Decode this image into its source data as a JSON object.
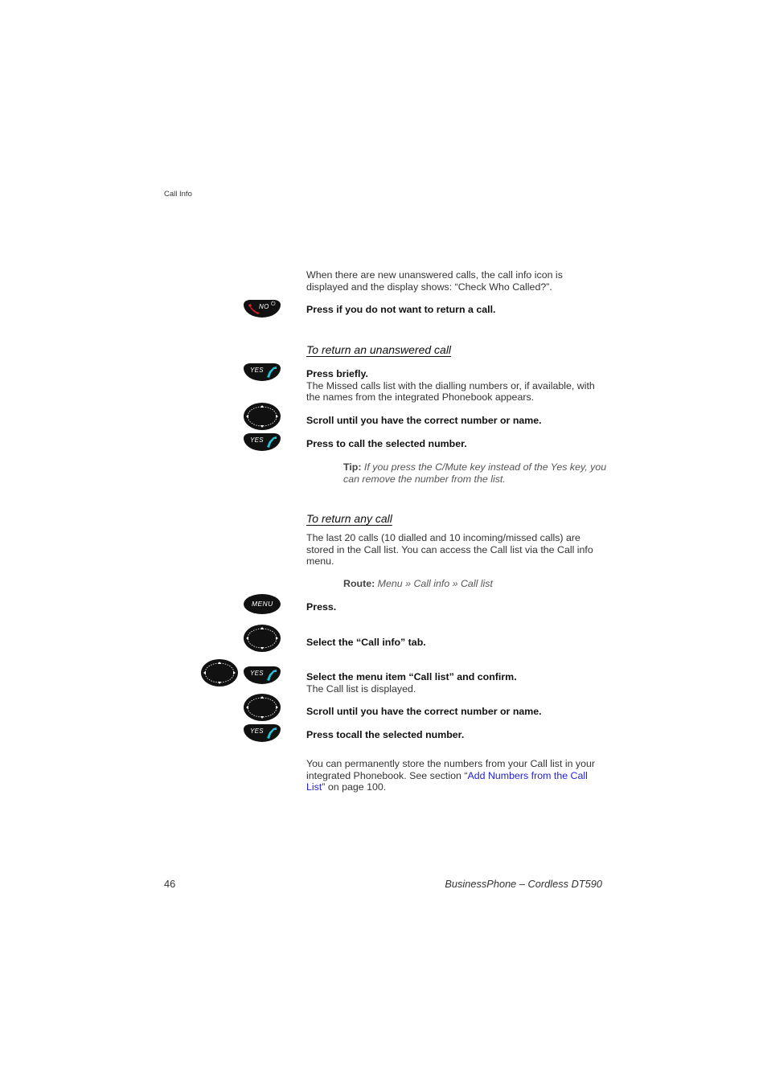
{
  "header": {
    "running_head": "Call Info"
  },
  "intro": {
    "text_line1": "When there are new unanswered calls, the call info icon is",
    "text_line2": "displayed and the display shows: “Check Who Called?”.",
    "no_key_instruction": "Press if you do not want to return a call."
  },
  "keys": {
    "no_label": "NO",
    "yes_label": "YES",
    "menu_label": "MENU",
    "icon_colors": {
      "key_body": "#111111",
      "yes_handset": "#22c5d8",
      "no_handset": "#e0202a"
    }
  },
  "section1": {
    "title": "To return an unanswered call",
    "steps": [
      {
        "bold": "Press briefly.",
        "desc_line1": "The Missed calls list with the dialling numbers or, if available, with",
        "desc_line2": "the names from the integrated Phonebook appears."
      },
      {
        "bold": "Scroll until you have the correct number or name."
      },
      {
        "bold": "Press to call the selected number."
      }
    ],
    "tip": {
      "label": "Tip:",
      "line1": " If you press the C/Mute key instead of the Yes key, you",
      "line2": "can remove the number from the list."
    }
  },
  "section2": {
    "title": "To return any call",
    "para_line1": "The last 20 calls (10 dialled and 10 incoming/missed calls) are",
    "para_line2": "stored in the Call list. You can access the Call list via the Call info",
    "para_line3": "menu.",
    "route": {
      "label": "Route:",
      "path": " Menu » Call info » Call list"
    },
    "steps": [
      {
        "bold": "Press."
      },
      {
        "bold": "Select the “Call info” tab."
      },
      {
        "bold": "Select the menu item “Call list” and confirm.",
        "desc": "The Call list is displayed."
      },
      {
        "bold": "Scroll until you have the correct number or name."
      },
      {
        "bold": "Press tocall the selected number."
      }
    ],
    "closing": {
      "line1": "You can permanently store the numbers from your Call list in your",
      "line2_pre": "integrated Phonebook. See section “",
      "link_part1": "Add Numbers from the Call",
      "link_part2": "List",
      "line3_post": "” on page 100."
    }
  },
  "footer": {
    "page_number": "46",
    "product": "BusinessPhone – Cordless DT590"
  }
}
